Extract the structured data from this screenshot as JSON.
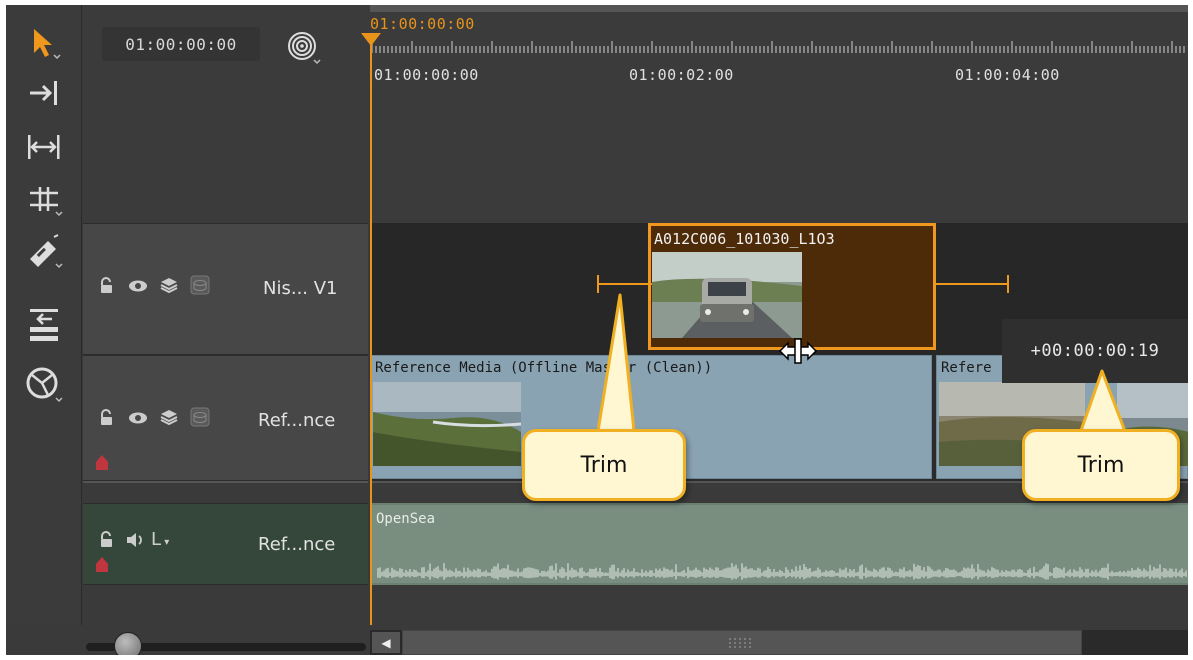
{
  "header": {
    "timecode": "01:00:00:00",
    "snap_icon": "target-icon"
  },
  "ruler": {
    "playhead_timecode": "01:00:00:00",
    "labels": [
      "01:00:00:00",
      "01:00:02:00",
      "01:00:04:00"
    ]
  },
  "toolbar": {
    "tools": [
      "select-arrow-icon",
      "track-forward-icon",
      "multi-trim-icon",
      "slip-icon",
      "razor-icon",
      "ripple-icon",
      "retime-icon"
    ]
  },
  "tracks": {
    "v1": {
      "name": "Nis... V1"
    },
    "ref": {
      "name": "Ref...nce"
    },
    "audio": {
      "name": "Ref...nce",
      "channel": "L"
    }
  },
  "clips": {
    "v1_clip": {
      "title": "A012C006_101030_L1O3"
    },
    "ref_clip_1": {
      "title": "Reference Media (Offline Master (Clean))"
    },
    "ref_clip_2": {
      "title": "Refere"
    },
    "audio_clip": {
      "title": "OpenSea"
    }
  },
  "trim_tooltip": {
    "value": "+00:00:00:19"
  },
  "callouts": [
    "Trim",
    "Trim"
  ],
  "colors": {
    "accent": "#f0981e",
    "callout_border": "#f0b022",
    "callout_fill": "#fff6d2",
    "reference_clip": "#8aa3b3",
    "audio_track": "#6a8070"
  }
}
